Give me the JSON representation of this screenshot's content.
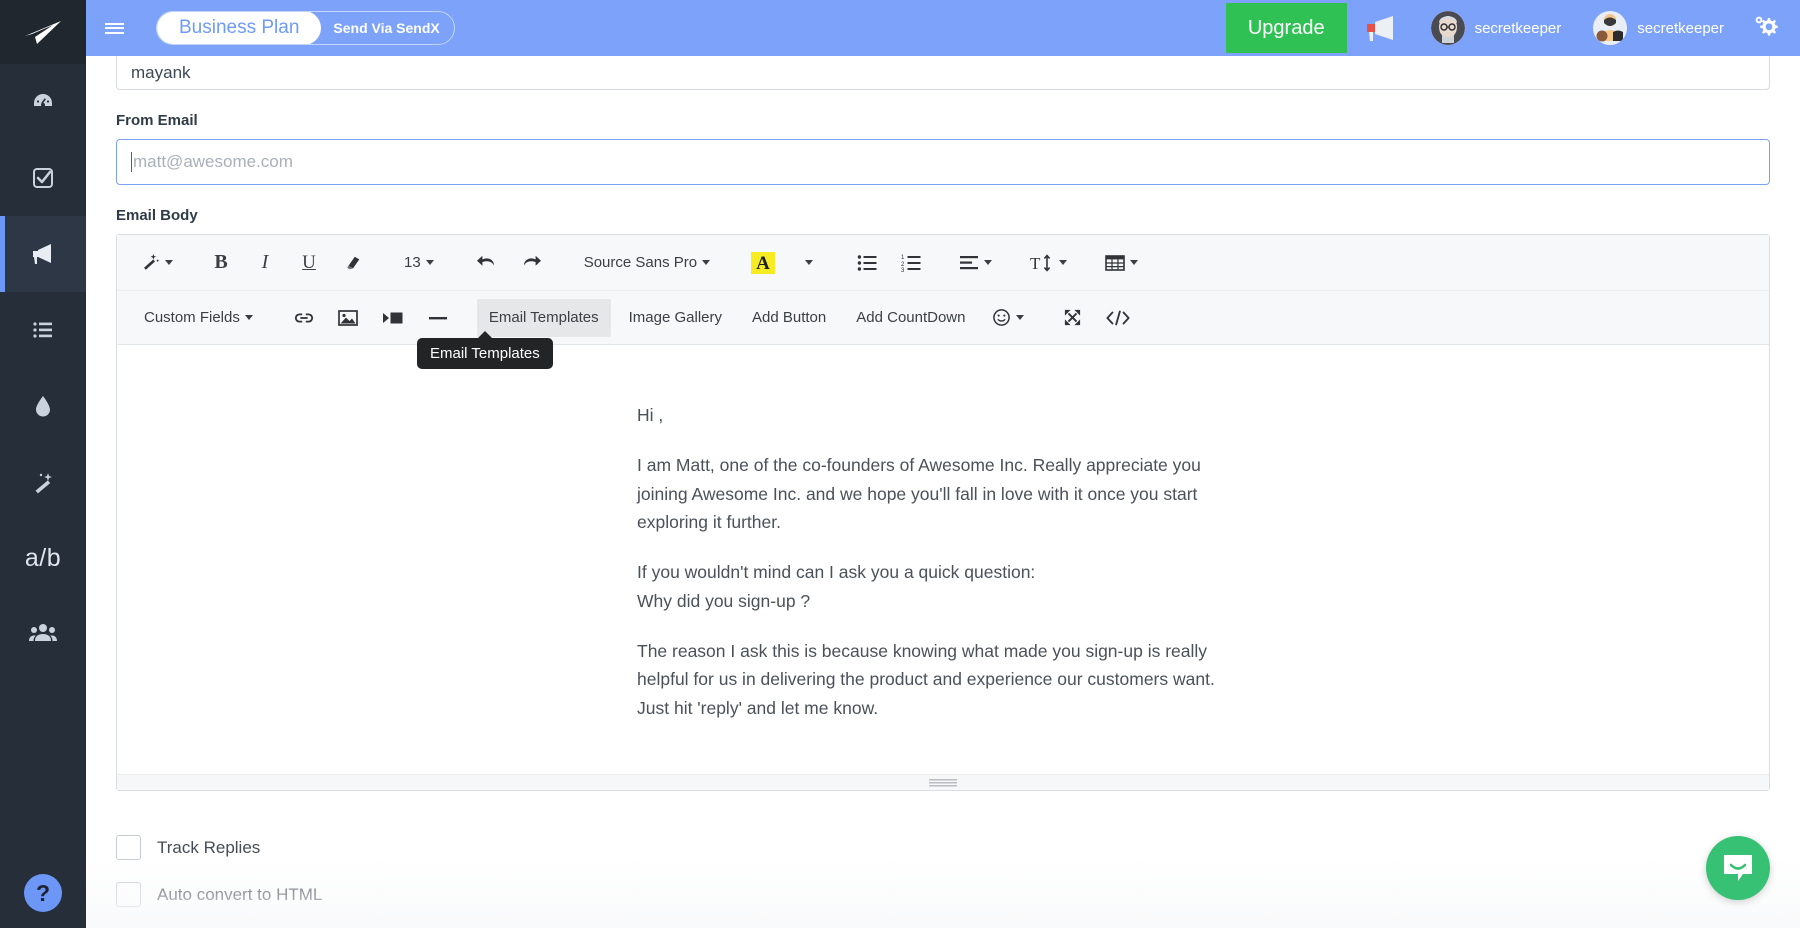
{
  "sidebar": {
    "logo_icon": "paper-plane-icon",
    "items": [
      {
        "icon": "dashboard-gauge-icon",
        "name": "dashboard",
        "active": false
      },
      {
        "icon": "checkbox-task-icon",
        "name": "tasks",
        "active": false
      },
      {
        "icon": "megaphone-icon",
        "name": "campaigns",
        "active": true
      },
      {
        "icon": "list-icon",
        "name": "lists",
        "active": false
      },
      {
        "icon": "droplet-icon",
        "name": "drip",
        "active": false
      },
      {
        "icon": "magic-wand-icon",
        "name": "automation",
        "active": false
      },
      {
        "icon": "ab-text",
        "name": "ab-testing",
        "label": "a/b",
        "active": false
      },
      {
        "icon": "users-group-icon",
        "name": "contacts",
        "active": false
      }
    ],
    "help_label": "?"
  },
  "topbar": {
    "menu_icon": "hamburger-icon",
    "plan_name": "Business Plan",
    "send_via": "Send Via SendX",
    "upgrade_label": "Upgrade",
    "announcement_icon": "megaphone-icon",
    "user1": "secretkeeper",
    "user2": "secretkeeper",
    "settings_icon": "gear-icon"
  },
  "form": {
    "from_name_value": "mayank",
    "from_email_label": "From Email",
    "from_email_placeholder": "matt@awesome.com",
    "from_email_value": "",
    "email_body_label": "Email Body"
  },
  "toolbar": {
    "row1": [
      {
        "name": "magic-wand-button",
        "kind": "icon",
        "icon": "magic-wand-icon",
        "caret": true
      },
      {
        "name": "bold-button",
        "kind": "glyph",
        "label": "B",
        "style": "bold"
      },
      {
        "name": "italic-button",
        "kind": "glyph",
        "label": "I",
        "style": "italic"
      },
      {
        "name": "underline-button",
        "kind": "glyph",
        "label": "U",
        "style": "underline"
      },
      {
        "name": "clear-format-button",
        "kind": "icon",
        "icon": "eraser-icon"
      },
      {
        "name": "font-size-dropdown",
        "kind": "text",
        "label": "13",
        "caret": true
      },
      {
        "name": "undo-button",
        "kind": "icon",
        "icon": "undo-arrow-icon"
      },
      {
        "name": "redo-button",
        "kind": "icon",
        "icon": "redo-arrow-icon"
      },
      {
        "name": "font-family-dropdown",
        "kind": "text",
        "label": "Source Sans Pro",
        "caret": true
      },
      {
        "name": "text-color-button",
        "kind": "highlight",
        "label": "A",
        "caret": true
      },
      {
        "name": "unordered-list-button",
        "kind": "icon",
        "icon": "bullet-list-icon"
      },
      {
        "name": "ordered-list-button",
        "kind": "icon",
        "icon": "numbered-list-icon"
      },
      {
        "name": "align-dropdown",
        "kind": "icon",
        "icon": "align-left-icon",
        "caret": true
      },
      {
        "name": "line-height-dropdown",
        "kind": "icon",
        "icon": "line-height-icon",
        "caret": true
      },
      {
        "name": "table-dropdown",
        "kind": "icon",
        "icon": "table-grid-icon",
        "caret": true
      }
    ],
    "row2": [
      {
        "name": "custom-fields-dropdown",
        "kind": "text",
        "label": "Custom Fields",
        "caret": true
      },
      {
        "name": "insert-link-button",
        "kind": "icon",
        "icon": "link-chain-icon"
      },
      {
        "name": "insert-image-button",
        "kind": "icon",
        "icon": "image-icon"
      },
      {
        "name": "insert-video-button",
        "kind": "icon",
        "icon": "video-icon"
      },
      {
        "name": "horizontal-rule-button",
        "kind": "icon",
        "icon": "horizontal-rule-icon"
      },
      {
        "name": "email-templates-button",
        "kind": "text",
        "label": "Email Templates",
        "hovered": true
      },
      {
        "name": "image-gallery-button",
        "kind": "text",
        "label": "Image Gallery"
      },
      {
        "name": "add-button-button",
        "kind": "text",
        "label": "Add Button"
      },
      {
        "name": "add-countdown-button",
        "kind": "text",
        "label": "Add CountDown"
      },
      {
        "name": "emoji-dropdown",
        "kind": "icon",
        "icon": "smiley-face-icon",
        "caret": true
      },
      {
        "name": "fullscreen-button",
        "kind": "icon",
        "icon": "expand-arrows-icon"
      },
      {
        "name": "code-view-button",
        "kind": "icon",
        "icon": "code-brackets-icon"
      }
    ],
    "tooltip_text": "Email Templates"
  },
  "email_body": {
    "paragraphs": [
      "Hi ,",
      "I am Matt, one of the co-founders of Awesome Inc. Really appreciate you joining Awesome Inc. and we hope you'll fall in love with it once you start exploring it further.",
      "If you wouldn't mind can I ask you a quick question:\nWhy did you sign-up ?",
      "The reason I ask this is because knowing what made you sign-up is really helpful for us in delivering the product and experience our customers want. Just hit 'reply' and let me know."
    ]
  },
  "options": {
    "track_replies_label": "Track Replies",
    "track_replies_checked": false,
    "auto_convert_label": "Auto convert to HTML",
    "auto_convert_checked": false
  },
  "widgets": {
    "intercom_icon": "chat-bubble-icon"
  },
  "colors": {
    "topbar": "#7da2f9",
    "sidebar": "#262e3a",
    "upgrade": "#2fc154",
    "accent": "#6c97f7",
    "intercom": "#37c174",
    "highlight": "#f7ec21"
  }
}
